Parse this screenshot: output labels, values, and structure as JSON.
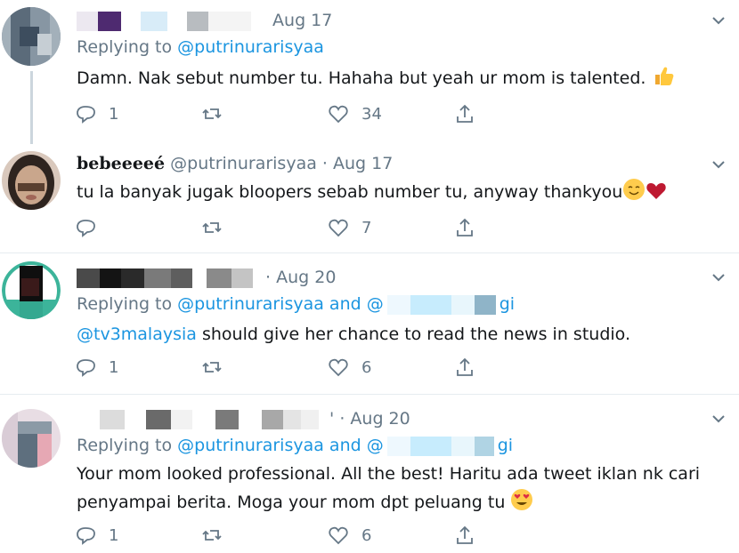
{
  "tweets": [
    {
      "date": "Aug 17",
      "replying_prefix": "Replying to",
      "replying_to": "@putrinurarisyaa",
      "text": "Damn. Nak sebut number tu. Hahaha but yeah ur mom is talented.",
      "emoji": "thumbs-up-emoji",
      "replies": "1",
      "likes": "34"
    },
    {
      "name": "bebeeeeé",
      "handle": "@putrinurarisyaa",
      "sep": "·",
      "date": "Aug 17",
      "text": "tu la banyak jugak bloopers sebab number tu, anyway thankyou",
      "emoji": "smiling-face-heart",
      "replies": "",
      "likes": "7"
    },
    {
      "sep": "·",
      "date": "Aug 20",
      "replying_prefix": "Replying to",
      "replying_to": "@putrinurarisyaa",
      "replying_and": "and",
      "replying_other_start": "@",
      "replying_other_end": "gi",
      "text_mention": "@tv3malaysia",
      "text": " should give her chance to read the news in studio.",
      "replies": "1",
      "likes": "6"
    },
    {
      "sep": "·",
      "date": "Aug 20",
      "name_fragment": "'",
      "replying_prefix": "Replying to",
      "replying_to": "@putrinurarisyaa",
      "replying_and": "and",
      "replying_other_start": "@",
      "replying_other_end": "gi",
      "text_line1": "Your mom looked professional. All the best! Haritu ada tweet iklan nk cari",
      "text_line2": "penyampai berita. Moga your mom dpt peluang tu",
      "emoji": "heart-eyes-emoji",
      "replies": "1",
      "likes": "6"
    }
  ],
  "colors": {
    "link": "#1b95e0",
    "secondary": "#657786",
    "divider": "#e6ecf0"
  }
}
